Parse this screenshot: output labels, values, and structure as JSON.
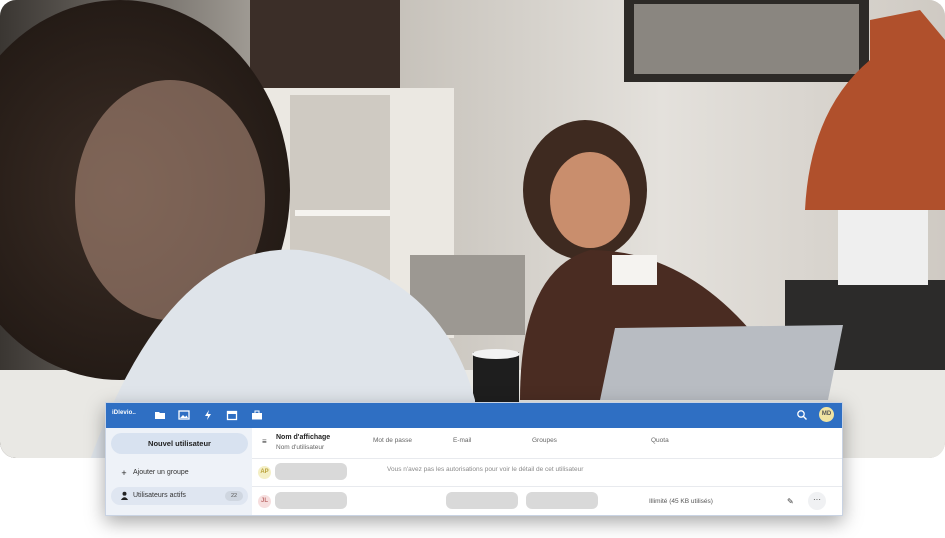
{
  "app": {
    "logo": "iDlevio.."
  },
  "toolbar": {
    "icons": [
      "folder-icon",
      "image-icon",
      "lightning-icon",
      "calendar-icon",
      "briefcase-icon",
      "search-icon"
    ],
    "avatar_initials": "MD"
  },
  "sidebar": {
    "new_user_label": "Nouvel utilisateur",
    "add_group_label": "Ajouter un groupe",
    "active_users_label": "Utilisateurs actifs",
    "active_users_count": "22"
  },
  "table": {
    "headers": {
      "display_name": "Nom d'affichage",
      "username": "Nom d'utilisateur",
      "password": "Mot de passe",
      "email": "E-mail",
      "groups": "Groupes",
      "quota": "Quota"
    },
    "rows": [
      {
        "initials": "AP",
        "avatar_color": "#f4efc5",
        "message": "Vous n'avez pas les autorisations pour voir le détail de cet utilisateur"
      },
      {
        "initials": "JL",
        "avatar_color": "#f6dede",
        "quota": "Illimité (45 KB utilisés)"
      }
    ]
  },
  "colors": {
    "topbar": "#2f6fc3",
    "sidebar": "#eef2f8"
  }
}
